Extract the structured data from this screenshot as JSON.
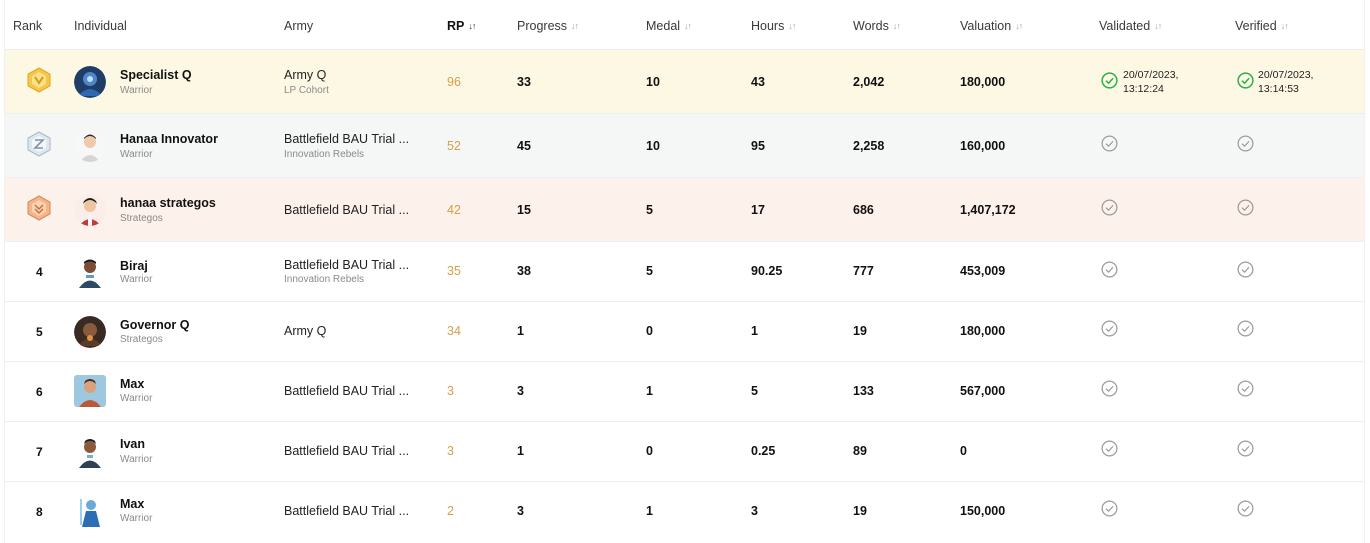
{
  "columns": {
    "rank": "Rank",
    "individual": "Individual",
    "army": "Army",
    "rp": "RP",
    "progress": "Progress",
    "medal": "Medal",
    "hours": "Hours",
    "words": "Words",
    "valuation": "Valuation",
    "validated": "Validated",
    "verified": "Verified"
  },
  "colors": {
    "rp": "#d4a04a",
    "gold_row": "#fdf8e4",
    "silver_row": "#f5f7f7",
    "bronze_row": "#fdf1ec",
    "check_green": "#2bb24c",
    "check_gray": "#9a9a9a"
  },
  "rows": [
    {
      "rank": "",
      "medal_icon": "gold-rank-badge-icon",
      "name": "Specialist Q",
      "role": "Warrior",
      "army": "Army Q",
      "army_sub": "LP Cohort",
      "rp": "96",
      "progress": "33",
      "medal": "10",
      "hours": "43",
      "words": "2,042",
      "valuation": "180,000",
      "validated": "20/07/2023, 13:12:24",
      "validated_line1": "20/07/2023,",
      "validated_line2": "13:12:24",
      "verified_line1": "20/07/2023,",
      "verified_line2": "13:14:53"
    },
    {
      "rank": "",
      "medal_icon": "silver-rank-badge-icon",
      "name": "Hanaa Innovator",
      "role": "Warrior",
      "army": "Battlefield BAU Trial ...",
      "army_sub": "Innovation Rebels",
      "rp": "52",
      "progress": "45",
      "medal": "10",
      "hours": "95",
      "words": "2,258",
      "valuation": "160,000"
    },
    {
      "rank": "",
      "medal_icon": "bronze-rank-badge-icon",
      "name": "hanaa strategos",
      "role": "Strategos",
      "army": "Battlefield BAU Trial ...",
      "army_sub": "",
      "rp": "42",
      "progress": "15",
      "medal": "5",
      "hours": "17",
      "words": "686",
      "valuation": "1,407,172"
    },
    {
      "rank": "4",
      "name": "Biraj",
      "role": "Warrior",
      "army": "Battlefield BAU Trial ...",
      "army_sub": "Innovation Rebels",
      "rp": "35",
      "progress": "38",
      "medal": "5",
      "hours": "90.25",
      "words": "777",
      "valuation": "453,009"
    },
    {
      "rank": "5",
      "name": "Governor Q",
      "role": "Strategos",
      "army": "Army Q",
      "army_sub": "",
      "rp": "34",
      "progress": "1",
      "medal": "0",
      "hours": "1",
      "words": "19",
      "valuation": "180,000"
    },
    {
      "rank": "6",
      "name": "Max",
      "role": "Warrior",
      "army": "Battlefield BAU Trial ...",
      "army_sub": "",
      "rp": "3",
      "progress": "3",
      "medal": "1",
      "hours": "5",
      "words": "133",
      "valuation": "567,000"
    },
    {
      "rank": "7",
      "name": "Ivan",
      "role": "Warrior",
      "army": "Battlefield BAU Trial ...",
      "army_sub": "",
      "rp": "3",
      "progress": "1",
      "medal": "0",
      "hours": "0.25",
      "words": "89",
      "valuation": "0"
    },
    {
      "rank": "8",
      "name": "Max",
      "role": "Warrior",
      "army": "Battlefield BAU Trial ...",
      "army_sub": "",
      "rp": "2",
      "progress": "3",
      "medal": "1",
      "hours": "3",
      "words": "19",
      "valuation": "150,000"
    }
  ]
}
